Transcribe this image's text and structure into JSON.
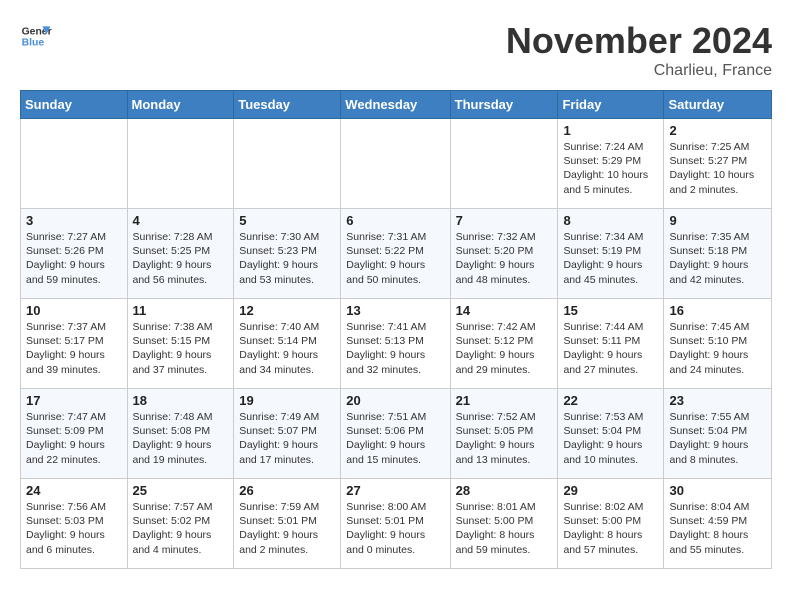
{
  "header": {
    "logo_line1": "General",
    "logo_line2": "Blue",
    "month": "November 2024",
    "location": "Charlieu, France"
  },
  "weekdays": [
    "Sunday",
    "Monday",
    "Tuesday",
    "Wednesday",
    "Thursday",
    "Friday",
    "Saturday"
  ],
  "weeks": [
    [
      {
        "day": "",
        "info": ""
      },
      {
        "day": "",
        "info": ""
      },
      {
        "day": "",
        "info": ""
      },
      {
        "day": "",
        "info": ""
      },
      {
        "day": "",
        "info": ""
      },
      {
        "day": "1",
        "info": "Sunrise: 7:24 AM\nSunset: 5:29 PM\nDaylight: 10 hours\nand 5 minutes."
      },
      {
        "day": "2",
        "info": "Sunrise: 7:25 AM\nSunset: 5:27 PM\nDaylight: 10 hours\nand 2 minutes."
      }
    ],
    [
      {
        "day": "3",
        "info": "Sunrise: 7:27 AM\nSunset: 5:26 PM\nDaylight: 9 hours\nand 59 minutes."
      },
      {
        "day": "4",
        "info": "Sunrise: 7:28 AM\nSunset: 5:25 PM\nDaylight: 9 hours\nand 56 minutes."
      },
      {
        "day": "5",
        "info": "Sunrise: 7:30 AM\nSunset: 5:23 PM\nDaylight: 9 hours\nand 53 minutes."
      },
      {
        "day": "6",
        "info": "Sunrise: 7:31 AM\nSunset: 5:22 PM\nDaylight: 9 hours\nand 50 minutes."
      },
      {
        "day": "7",
        "info": "Sunrise: 7:32 AM\nSunset: 5:20 PM\nDaylight: 9 hours\nand 48 minutes."
      },
      {
        "day": "8",
        "info": "Sunrise: 7:34 AM\nSunset: 5:19 PM\nDaylight: 9 hours\nand 45 minutes."
      },
      {
        "day": "9",
        "info": "Sunrise: 7:35 AM\nSunset: 5:18 PM\nDaylight: 9 hours\nand 42 minutes."
      }
    ],
    [
      {
        "day": "10",
        "info": "Sunrise: 7:37 AM\nSunset: 5:17 PM\nDaylight: 9 hours\nand 39 minutes."
      },
      {
        "day": "11",
        "info": "Sunrise: 7:38 AM\nSunset: 5:15 PM\nDaylight: 9 hours\nand 37 minutes."
      },
      {
        "day": "12",
        "info": "Sunrise: 7:40 AM\nSunset: 5:14 PM\nDaylight: 9 hours\nand 34 minutes."
      },
      {
        "day": "13",
        "info": "Sunrise: 7:41 AM\nSunset: 5:13 PM\nDaylight: 9 hours\nand 32 minutes."
      },
      {
        "day": "14",
        "info": "Sunrise: 7:42 AM\nSunset: 5:12 PM\nDaylight: 9 hours\nand 29 minutes."
      },
      {
        "day": "15",
        "info": "Sunrise: 7:44 AM\nSunset: 5:11 PM\nDaylight: 9 hours\nand 27 minutes."
      },
      {
        "day": "16",
        "info": "Sunrise: 7:45 AM\nSunset: 5:10 PM\nDaylight: 9 hours\nand 24 minutes."
      }
    ],
    [
      {
        "day": "17",
        "info": "Sunrise: 7:47 AM\nSunset: 5:09 PM\nDaylight: 9 hours\nand 22 minutes."
      },
      {
        "day": "18",
        "info": "Sunrise: 7:48 AM\nSunset: 5:08 PM\nDaylight: 9 hours\nand 19 minutes."
      },
      {
        "day": "19",
        "info": "Sunrise: 7:49 AM\nSunset: 5:07 PM\nDaylight: 9 hours\nand 17 minutes."
      },
      {
        "day": "20",
        "info": "Sunrise: 7:51 AM\nSunset: 5:06 PM\nDaylight: 9 hours\nand 15 minutes."
      },
      {
        "day": "21",
        "info": "Sunrise: 7:52 AM\nSunset: 5:05 PM\nDaylight: 9 hours\nand 13 minutes."
      },
      {
        "day": "22",
        "info": "Sunrise: 7:53 AM\nSunset: 5:04 PM\nDaylight: 9 hours\nand 10 minutes."
      },
      {
        "day": "23",
        "info": "Sunrise: 7:55 AM\nSunset: 5:04 PM\nDaylight: 9 hours\nand 8 minutes."
      }
    ],
    [
      {
        "day": "24",
        "info": "Sunrise: 7:56 AM\nSunset: 5:03 PM\nDaylight: 9 hours\nand 6 minutes."
      },
      {
        "day": "25",
        "info": "Sunrise: 7:57 AM\nSunset: 5:02 PM\nDaylight: 9 hours\nand 4 minutes."
      },
      {
        "day": "26",
        "info": "Sunrise: 7:59 AM\nSunset: 5:01 PM\nDaylight: 9 hours\nand 2 minutes."
      },
      {
        "day": "27",
        "info": "Sunrise: 8:00 AM\nSunset: 5:01 PM\nDaylight: 9 hours\nand 0 minutes."
      },
      {
        "day": "28",
        "info": "Sunrise: 8:01 AM\nSunset: 5:00 PM\nDaylight: 8 hours\nand 59 minutes."
      },
      {
        "day": "29",
        "info": "Sunrise: 8:02 AM\nSunset: 5:00 PM\nDaylight: 8 hours\nand 57 minutes."
      },
      {
        "day": "30",
        "info": "Sunrise: 8:04 AM\nSunset: 4:59 PM\nDaylight: 8 hours\nand 55 minutes."
      }
    ]
  ]
}
